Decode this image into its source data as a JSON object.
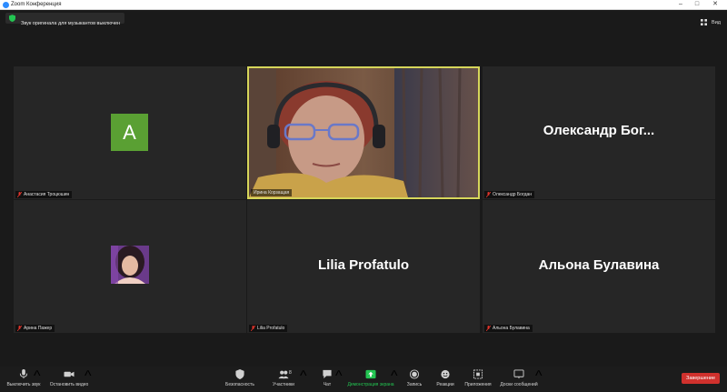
{
  "window": {
    "title": "Zoom Конференция",
    "controls": [
      "–",
      "□",
      "✕"
    ]
  },
  "notice": {
    "text": "Звук оригинала для музыкантов выключен"
  },
  "view_button": {
    "label": "Вид"
  },
  "participants": [
    {
      "name": "Анастасия Троцюшин",
      "display": "avatar-letter",
      "avatar_letter": "A",
      "avatar_color": "#5aa033",
      "muted": true
    },
    {
      "name": "Ирина Корзащая",
      "display": "video",
      "active_speaker": true,
      "muted": false
    },
    {
      "name": "Олександр Богдан",
      "display": "name",
      "display_name": "Олександр  Бог...",
      "muted": true
    },
    {
      "name": "Арина Пажер",
      "display": "avatar-photo",
      "muted": true
    },
    {
      "name": "Lilia Profatulo",
      "display": "name",
      "display_name": "Lilia Profatulo",
      "muted": true
    },
    {
      "name": "Альона Булавина",
      "display": "name",
      "display_name": "Альона Булавина",
      "muted": true
    }
  ],
  "toolbar": {
    "mute_label": "Выключить звук",
    "video_label": "Остановить видео",
    "security_label": "Безопасность",
    "participants_label": "Участники",
    "participants_count": "8",
    "chat_label": "Чат",
    "share_label": "Демонстрация экрана",
    "record_label": "Запись",
    "reactions_label": "Реакции",
    "apps_label": "Приложения",
    "whiteboard_label": "Доски сообщений",
    "end_label": "Завершение"
  },
  "colors": {
    "share_green": "#23c552",
    "end_red": "#d0312d",
    "active_border": "#d6d65a",
    "mute_red": "#e0342b"
  }
}
